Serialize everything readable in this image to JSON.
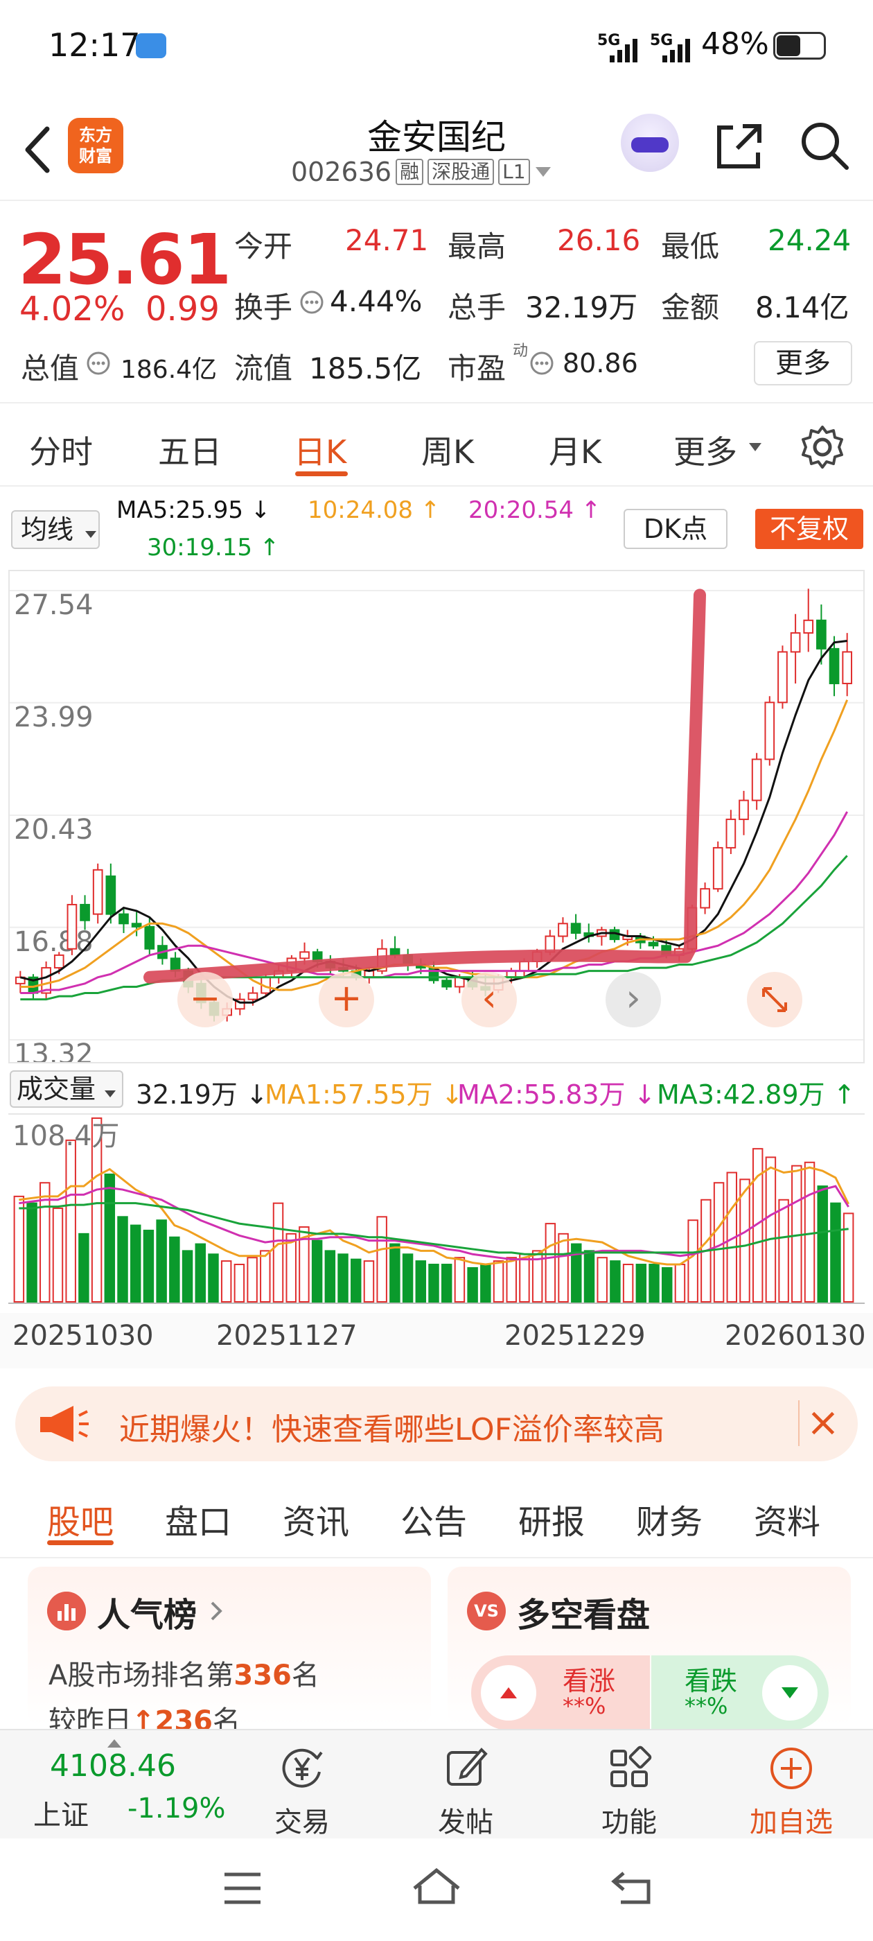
{
  "status_bar": {
    "time": "12:17",
    "signal1": "5G",
    "signal2": "5G",
    "battery": "48%"
  },
  "header": {
    "logo_line1": "东方",
    "logo_line2": "财富",
    "stock_name": "金安国纪",
    "stock_code": "002636",
    "tag_margin": "融",
    "tag_connect": "深股通",
    "tag_level": "L1"
  },
  "quote": {
    "price": "25.61",
    "change_pct": "4.02%",
    "change": "0.99",
    "open_label": "今开",
    "open": "24.71",
    "high_label": "最高",
    "high": "26.16",
    "low_label": "最低",
    "low": "24.24",
    "turnover_label": "换手",
    "turnover": "4.44%",
    "volume_label": "总手",
    "volume": "32.19万",
    "amount_label": "金额",
    "amount": "8.14亿",
    "mcap_label": "总值",
    "mcap": "186.4亿",
    "float_label": "流值",
    "float": "185.5亿",
    "pe_label": "市盈",
    "pe_sup": "动",
    "pe": "80.86",
    "more": "更多"
  },
  "chart_tabs": [
    "分时",
    "五日",
    "日K",
    "周K",
    "月K",
    "更多"
  ],
  "ma_legend": {
    "select": "均线",
    "ma5": "MA5:25.95 ↓",
    "ma10": "10:24.08 ↑",
    "ma20": "20:20.54 ↑",
    "ma30": "30:19.15 ↑",
    "dk": "DK点",
    "no_adjust": "不复权"
  },
  "vol_legend": {
    "select": "成交量",
    "vol": "32.19万 ↓",
    "ma1": "MA1:57.55万 ↓",
    "ma2": "MA2:55.83万 ↓",
    "ma3": "MA3:42.89万 ↑"
  },
  "colors": {
    "up": "#e02e2e",
    "down": "#0a9a2c",
    "ma5": "#111111",
    "ma10": "#f0a020",
    "ma20": "#d030b0",
    "ma30": "#19a33a",
    "accent": "#e2541f",
    "annotation": "#d94a5a"
  },
  "chart_data": [
    {
      "type": "candlestick",
      "title": "",
      "y_ticks": [
        "27.54",
        "23.99",
        "20.43",
        "16.88",
        "13.32"
      ],
      "ylim": [
        13.32,
        27.54
      ],
      "x_ticks": [
        "20251030",
        "20251127",
        "20251229",
        "20260130"
      ],
      "ohlc": [
        [
          15.1,
          15.5,
          14.8,
          15.3
        ],
        [
          15.3,
          15.4,
          14.6,
          14.8
        ],
        [
          14.8,
          15.8,
          14.6,
          15.6
        ],
        [
          15.6,
          16.1,
          15.4,
          16.0
        ],
        [
          16.2,
          17.9,
          16.0,
          17.6
        ],
        [
          17.6,
          17.9,
          16.8,
          17.1
        ],
        [
          17.3,
          18.9,
          17.0,
          18.7
        ],
        [
          18.5,
          18.9,
          17.0,
          17.3
        ],
        [
          17.3,
          17.5,
          16.7,
          17.0
        ],
        [
          17.0,
          17.4,
          16.6,
          16.9
        ],
        [
          16.9,
          17.2,
          16.0,
          16.2
        ],
        [
          16.3,
          16.6,
          15.7,
          15.9
        ],
        [
          15.9,
          16.1,
          15.3,
          15.5
        ],
        [
          15.5,
          15.6,
          14.8,
          15.0
        ],
        [
          15.1,
          15.4,
          14.3,
          14.5
        ],
        [
          14.5,
          14.6,
          13.9,
          14.1
        ],
        [
          14.1,
          14.5,
          13.9,
          14.3
        ],
        [
          14.3,
          14.8,
          14.1,
          14.6
        ],
        [
          14.6,
          15.0,
          14.4,
          14.8
        ],
        [
          14.8,
          15.4,
          14.7,
          15.3
        ],
        [
          15.3,
          15.7,
          15.1,
          15.5
        ],
        [
          15.5,
          16.0,
          15.3,
          15.9
        ],
        [
          15.9,
          16.4,
          15.7,
          16.1
        ],
        [
          16.1,
          16.2,
          15.6,
          15.8
        ],
        [
          15.8,
          16.0,
          15.4,
          15.6
        ],
        [
          15.6,
          15.9,
          15.3,
          15.5
        ],
        [
          15.5,
          15.7,
          15.2,
          15.3
        ],
        [
          15.3,
          15.6,
          15.1,
          15.5
        ],
        [
          15.5,
          16.5,
          15.4,
          16.2
        ],
        [
          16.2,
          16.6,
          15.9,
          16.0
        ],
        [
          16.0,
          16.2,
          15.5,
          15.7
        ],
        [
          15.7,
          15.9,
          15.4,
          15.6
        ],
        [
          15.6,
          15.8,
          15.1,
          15.2
        ],
        [
          15.2,
          15.3,
          14.9,
          15.0
        ],
        [
          15.0,
          15.4,
          14.8,
          15.3
        ],
        [
          15.3,
          15.5,
          14.9,
          15.0
        ],
        [
          15.0,
          15.4,
          14.7,
          14.9
        ],
        [
          14.9,
          15.4,
          14.8,
          15.3
        ],
        [
          15.3,
          15.6,
          15.1,
          15.5
        ],
        [
          15.5,
          15.9,
          15.3,
          15.8
        ],
        [
          15.8,
          16.2,
          15.6,
          16.1
        ],
        [
          16.1,
          16.8,
          16.0,
          16.6
        ],
        [
          16.6,
          17.2,
          16.4,
          17.0
        ],
        [
          17.0,
          17.3,
          16.5,
          16.7
        ],
        [
          16.7,
          17.0,
          16.4,
          16.6
        ],
        [
          16.6,
          16.9,
          16.3,
          16.8
        ],
        [
          16.8,
          16.9,
          16.4,
          16.5
        ],
        [
          16.5,
          16.8,
          16.3,
          16.6
        ],
        [
          16.6,
          16.7,
          16.2,
          16.4
        ],
        [
          16.4,
          16.6,
          16.2,
          16.3
        ],
        [
          16.3,
          16.5,
          15.9,
          16.0
        ],
        [
          16.0,
          16.3,
          15.8,
          16.2
        ],
        [
          16.2,
          17.6,
          16.1,
          17.5
        ],
        [
          17.5,
          18.3,
          17.3,
          18.1
        ],
        [
          18.1,
          19.6,
          18.0,
          19.4
        ],
        [
          19.4,
          20.6,
          19.2,
          20.3
        ],
        [
          20.3,
          21.2,
          19.8,
          20.9
        ],
        [
          20.9,
          22.4,
          20.6,
          22.2
        ],
        [
          22.2,
          24.2,
          22.0,
          24.0
        ],
        [
          24.0,
          25.8,
          23.8,
          25.6
        ],
        [
          25.6,
          26.8,
          24.6,
          26.2
        ],
        [
          26.2,
          27.6,
          25.6,
          26.6
        ],
        [
          26.6,
          27.1,
          25.2,
          25.7
        ],
        [
          25.7,
          26.1,
          24.2,
          24.6
        ],
        [
          24.6,
          26.2,
          24.2,
          25.6
        ]
      ],
      "series": [
        {
          "name": "MA5",
          "values": [
            15.3,
            15.2,
            15.3,
            15.5,
            15.8,
            16.2,
            16.7,
            17.2,
            17.5,
            17.4,
            17.2,
            16.8,
            16.3,
            15.9,
            15.4,
            15.0,
            14.7,
            14.5,
            14.5,
            14.7,
            15.0,
            15.2,
            15.5,
            15.7,
            15.8,
            15.7,
            15.6,
            15.5,
            15.6,
            15.7,
            15.7,
            15.7,
            15.6,
            15.4,
            15.3,
            15.2,
            15.1,
            15.1,
            15.2,
            15.3,
            15.5,
            15.8,
            16.2,
            16.4,
            16.6,
            16.7,
            16.7,
            16.6,
            16.6,
            16.5,
            16.4,
            16.3,
            16.5,
            16.8,
            17.3,
            18.1,
            18.9,
            19.9,
            21.0,
            22.4,
            23.6,
            24.7,
            25.4,
            25.9,
            25.95
          ]
        },
        {
          "name": "MA10",
          "values": [
            15.0,
            15.0,
            15.1,
            15.2,
            15.4,
            15.6,
            15.9,
            16.2,
            16.5,
            16.8,
            17.0,
            17.0,
            16.9,
            16.7,
            16.4,
            16.1,
            15.8,
            15.5,
            15.2,
            15.0,
            14.9,
            14.9,
            15.0,
            15.1,
            15.3,
            15.4,
            15.5,
            15.6,
            15.6,
            15.7,
            15.7,
            15.7,
            15.6,
            15.6,
            15.5,
            15.4,
            15.4,
            15.3,
            15.3,
            15.3,
            15.3,
            15.4,
            15.6,
            15.8,
            15.9,
            16.1,
            16.2,
            16.4,
            16.5,
            16.5,
            16.5,
            16.5,
            16.6,
            16.7,
            16.9,
            17.2,
            17.6,
            18.1,
            18.7,
            19.5,
            20.3,
            21.2,
            22.2,
            23.1,
            24.08
          ]
        },
        {
          "name": "MA20",
          "values": [
            14.8,
            14.8,
            14.9,
            14.9,
            15.0,
            15.1,
            15.3,
            15.4,
            15.6,
            15.8,
            16.0,
            16.1,
            16.2,
            16.3,
            16.3,
            16.2,
            16.1,
            16.0,
            15.9,
            15.8,
            15.7,
            15.6,
            15.5,
            15.4,
            15.4,
            15.3,
            15.3,
            15.3,
            15.3,
            15.4,
            15.4,
            15.5,
            15.5,
            15.5,
            15.5,
            15.5,
            15.5,
            15.5,
            15.5,
            15.5,
            15.5,
            15.5,
            15.6,
            15.6,
            15.7,
            15.7,
            15.8,
            15.8,
            15.9,
            15.9,
            16.0,
            16.0,
            16.1,
            16.2,
            16.3,
            16.5,
            16.7,
            17.0,
            17.3,
            17.7,
            18.1,
            18.6,
            19.2,
            19.8,
            20.54
          ]
        },
        {
          "name": "MA30",
          "values": [
            14.6,
            14.6,
            14.6,
            14.7,
            14.7,
            14.8,
            14.8,
            14.9,
            15.0,
            15.0,
            15.1,
            15.2,
            15.2,
            15.3,
            15.3,
            15.3,
            15.3,
            15.3,
            15.3,
            15.3,
            15.3,
            15.3,
            15.3,
            15.3,
            15.3,
            15.3,
            15.3,
            15.3,
            15.3,
            15.3,
            15.3,
            15.3,
            15.3,
            15.3,
            15.3,
            15.3,
            15.3,
            15.3,
            15.3,
            15.3,
            15.4,
            15.4,
            15.4,
            15.4,
            15.5,
            15.5,
            15.5,
            15.5,
            15.6,
            15.6,
            15.6,
            15.7,
            15.7,
            15.8,
            15.9,
            16.0,
            16.2,
            16.4,
            16.7,
            17.0,
            17.4,
            17.8,
            18.2,
            18.7,
            19.15
          ]
        }
      ]
    },
    {
      "type": "bar",
      "title": "",
      "y_ticks": [
        "108.4万"
      ],
      "ylim": [
        0,
        108.4
      ],
      "volumes": [
        62,
        58,
        70,
        55,
        95,
        40,
        108,
        75,
        50,
        45,
        42,
        48,
        38,
        30,
        34,
        28,
        24,
        22,
        26,
        30,
        58,
        40,
        44,
        36,
        30,
        28,
        25,
        24,
        50,
        34,
        28,
        24,
        22,
        22,
        26,
        20,
        22,
        24,
        26,
        28,
        30,
        46,
        40,
        34,
        30,
        26,
        24,
        22,
        22,
        22,
        20,
        22,
        48,
        60,
        70,
        76,
        72,
        90,
        85,
        60,
        80,
        82,
        68,
        58,
        52
      ],
      "series": [
        {
          "name": "MA1",
          "values": [
            60,
            61,
            62,
            62,
            68,
            68,
            74,
            78,
            72,
            66,
            62,
            55,
            45,
            42,
            38,
            34,
            30,
            27,
            27,
            27,
            34,
            35,
            38,
            40,
            42,
            36,
            33,
            29,
            31,
            32,
            32,
            30,
            30,
            26,
            25,
            23,
            22,
            23,
            24,
            26,
            28,
            33,
            36,
            37,
            36,
            35,
            31,
            27,
            25,
            23,
            22,
            22,
            27,
            35,
            44,
            55,
            65,
            74,
            79,
            76,
            77,
            79,
            77,
            73,
            57.55
          ]
        },
        {
          "name": "MA2",
          "values": [
            58,
            59,
            60,
            60,
            63,
            63,
            66,
            67,
            66,
            64,
            62,
            60,
            56,
            52,
            48,
            45,
            42,
            39,
            37,
            35,
            36,
            36,
            37,
            37,
            38,
            38,
            38,
            36,
            36,
            36,
            35,
            34,
            33,
            31,
            30,
            28,
            27,
            26,
            25,
            25,
            25,
            26,
            27,
            28,
            29,
            30,
            30,
            30,
            30,
            29,
            28,
            27,
            28,
            30,
            33,
            37,
            41,
            46,
            51,
            55,
            59,
            63,
            66,
            68,
            55.83
          ]
        },
        {
          "name": "MA3",
          "values": [
            55,
            55,
            56,
            56,
            57,
            57,
            58,
            58,
            58,
            58,
            57,
            56,
            55,
            54,
            52,
            50,
            48,
            46,
            45,
            44,
            43,
            42,
            41,
            40,
            40,
            40,
            39,
            38,
            38,
            37,
            36,
            35,
            34,
            33,
            32,
            31,
            30,
            29,
            29,
            28,
            28,
            28,
            28,
            29,
            29,
            29,
            29,
            29,
            29,
            29,
            29,
            29,
            29,
            30,
            31,
            32,
            33,
            35,
            37,
            38,
            39,
            40,
            41,
            42,
            42.89
          ]
        }
      ]
    }
  ],
  "chart_nav": {
    "zoom_out": "−",
    "zoom_in": "+",
    "prev": "‹",
    "next": "›"
  },
  "banner": {
    "text": "近期爆火！快速查看哪些LOF溢价率较高"
  },
  "sub_tabs": [
    "股吧",
    "盘口",
    "资讯",
    "公告",
    "研报",
    "财务",
    "资料"
  ],
  "popularity": {
    "title": "人气榜",
    "line1_prefix": "A股市场排名第",
    "line1_rank": "336",
    "line1_suffix": "名",
    "line2_prefix": "较昨日",
    "line2_change": "↑236",
    "line2_suffix": "名"
  },
  "sentiment": {
    "title": "多空看盘",
    "icon_text": "VS",
    "rise_label": "看涨",
    "rise_pct": "**%",
    "fall_label": "看跌",
    "fall_pct": "**%"
  },
  "bottom_bar": {
    "index_value": "4108.46",
    "index_name": "上证",
    "index_change": "-1.19%",
    "trade": "交易",
    "post": "发帖",
    "function": "功能",
    "add": "加自选"
  }
}
